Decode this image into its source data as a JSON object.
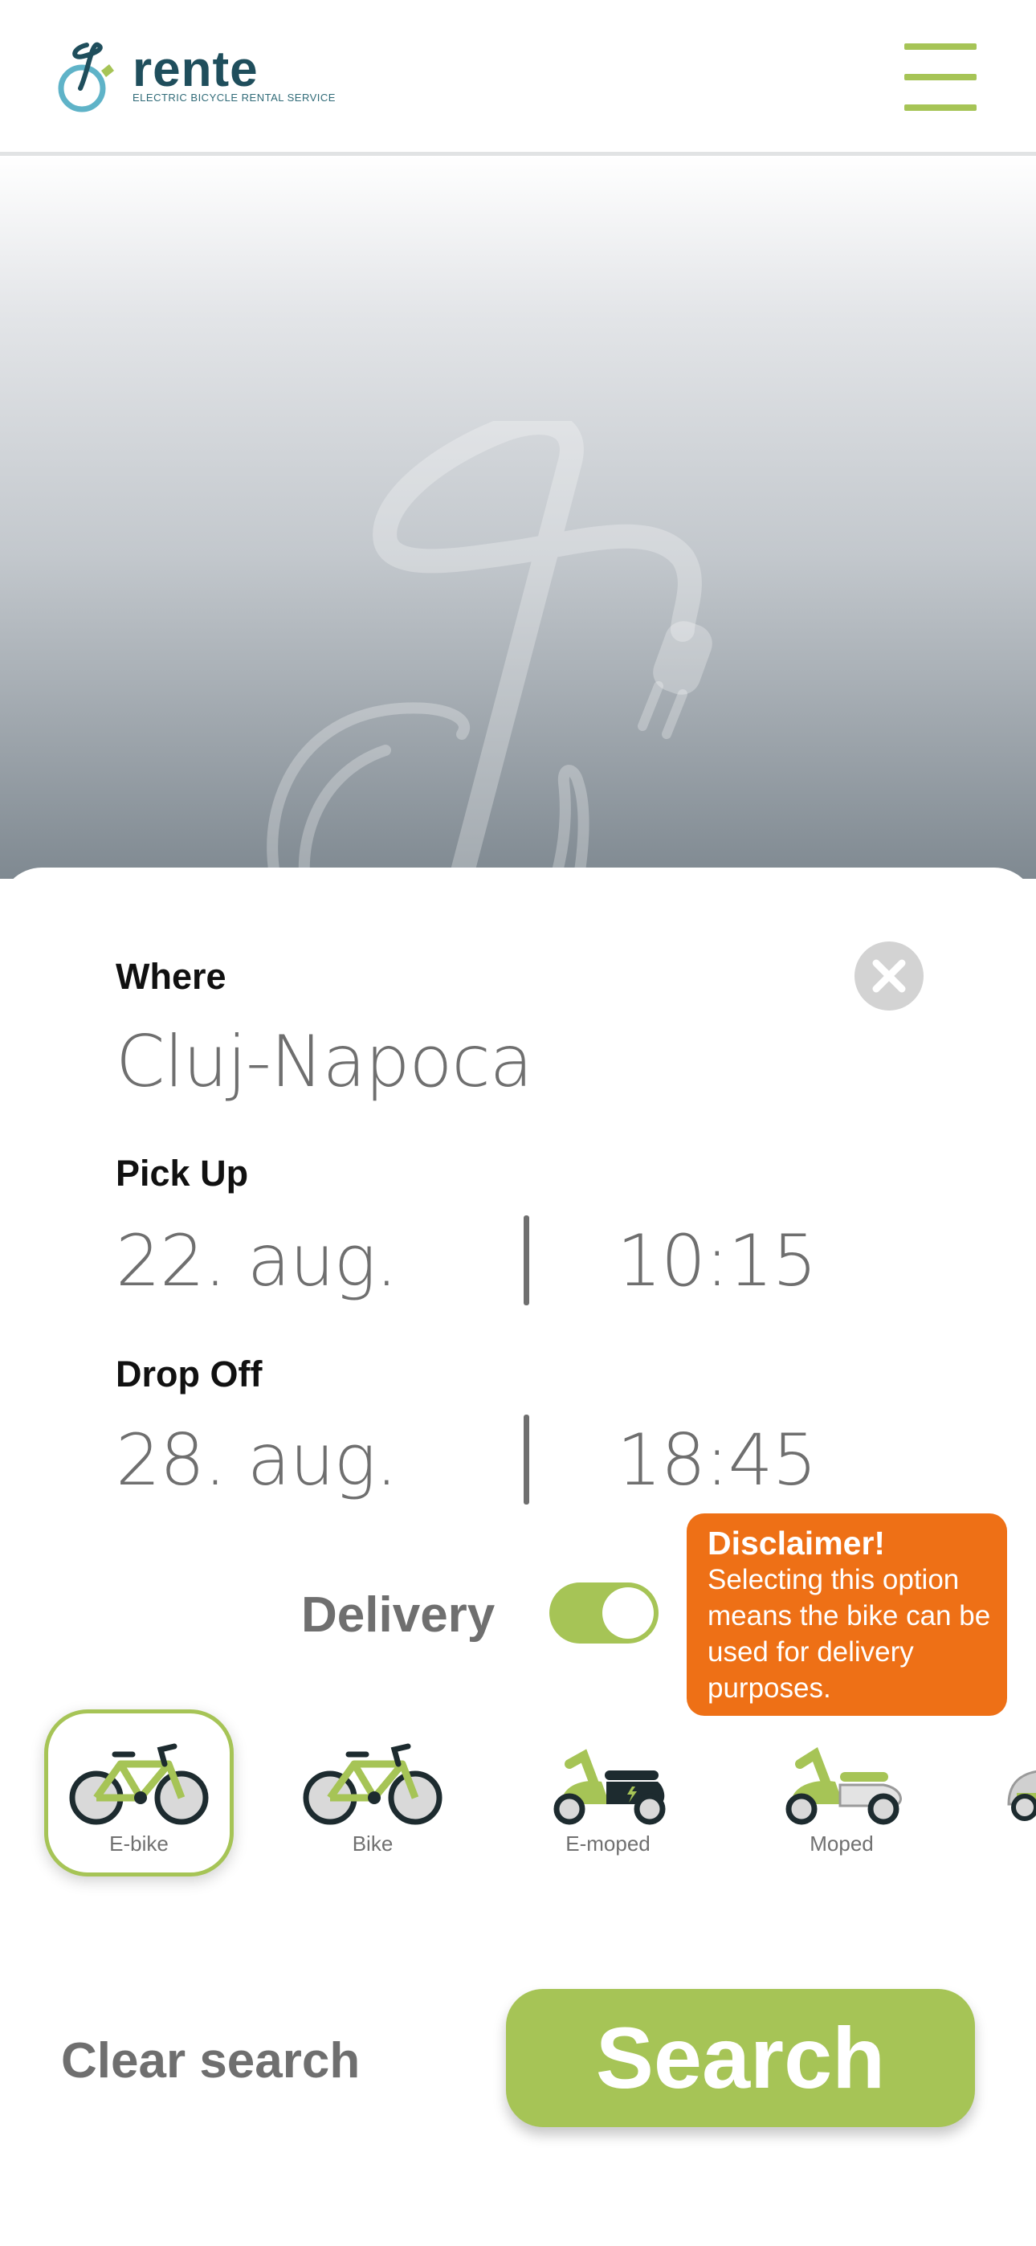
{
  "brand": {
    "name": "rente",
    "tagline": "ELECTRIC BICYCLE RENTAL SERVICE",
    "colors": {
      "accent": "#a6c456",
      "dark": "#1f4e5c",
      "warning": "#ee7016"
    }
  },
  "header": {
    "menu_icon": "hamburger-menu-icon"
  },
  "form": {
    "where": {
      "label": "Where",
      "value": "Cluj-Napoca",
      "clear_icon": "close-icon"
    },
    "pickup": {
      "label": "Pick Up",
      "date": "22. aug.",
      "time": "10:15"
    },
    "dropoff": {
      "label": "Drop Off",
      "date": "28. aug.",
      "time": "18:45"
    },
    "delivery": {
      "label": "Delivery",
      "enabled": true
    }
  },
  "disclaimer": {
    "title": "Disclaimer!",
    "text": "Selecting this option means the bike can be used for delivery purposes."
  },
  "vehicles": [
    {
      "label": "E-bike",
      "icon": "e-bike-icon",
      "selected": true
    },
    {
      "label": "Bike",
      "icon": "bike-icon",
      "selected": false
    },
    {
      "label": "E-moped",
      "icon": "e-moped-icon",
      "selected": false
    },
    {
      "label": "Moped",
      "icon": "moped-icon",
      "selected": false
    },
    {
      "label": "",
      "icon": "car-icon",
      "selected": false
    }
  ],
  "actions": {
    "clear": "Clear search",
    "search": "Search"
  }
}
